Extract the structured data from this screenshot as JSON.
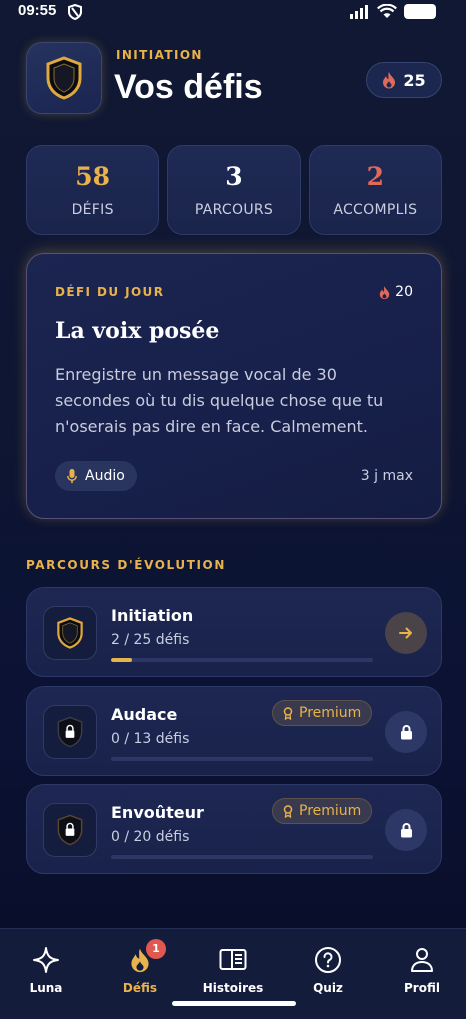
{
  "status_bar": {
    "time": "09:55"
  },
  "header": {
    "eyebrow": "INITIATION",
    "title": "Vos défis",
    "streak": "25"
  },
  "stats": [
    {
      "value": "58",
      "label": "DÉFIS",
      "color": "#e8b24c"
    },
    {
      "value": "3",
      "label": "PARCOURS",
      "color": "#ffffff"
    },
    {
      "value": "2",
      "label": "ACCOMPLIS",
      "color": "#e0695a"
    }
  ],
  "daily": {
    "eyebrow": "DÉFI DU JOUR",
    "points": "20",
    "title": "La voix posée",
    "description": "Enregistre un message vocal de 30 secondes où tu dis quelque chose que tu n'oserais pas dire en face. Calmement.",
    "chip": "Audio",
    "duration": "3 j max"
  },
  "section_title": "PARCOURS D'ÉVOLUTION",
  "paths": [
    {
      "name": "Initiation",
      "progress": "2 / 25 défis",
      "fraction": 0.08,
      "premium": "",
      "action": "arrow",
      "locked": false
    },
    {
      "name": "Audace",
      "progress": "0 / 13 défis",
      "fraction": 0,
      "premium": "Premium",
      "action": "lock",
      "locked": true
    },
    {
      "name": "Envoûteur",
      "progress": "0 / 20 défis",
      "fraction": 0,
      "premium": "Premium",
      "action": "lock",
      "locked": true
    }
  ],
  "nav": {
    "items": [
      {
        "label": "Luna",
        "icon": "sparkle-icon"
      },
      {
        "label": "Défis",
        "icon": "flame-icon",
        "badge": "1"
      },
      {
        "label": "Histoires",
        "icon": "book-icon"
      },
      {
        "label": "Quiz",
        "icon": "question-icon"
      },
      {
        "label": "Profil",
        "icon": "user-icon"
      }
    ],
    "active": "Défis"
  },
  "colors": {
    "accent": "#e8b24c",
    "flame": "#e0695a",
    "background": "#0e1633"
  }
}
